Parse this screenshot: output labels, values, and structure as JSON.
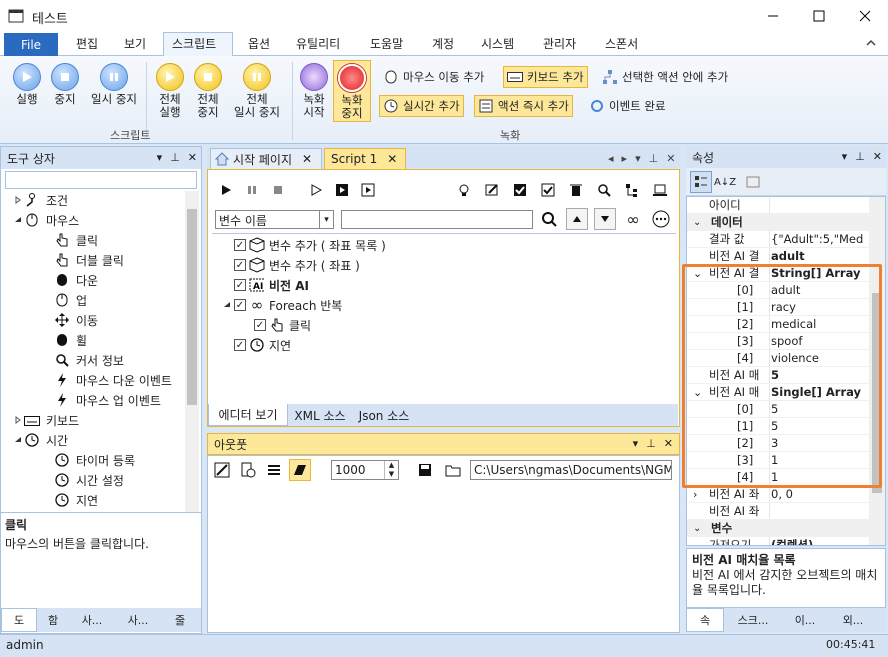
{
  "window": {
    "title": "테스트"
  },
  "menu": {
    "file": "File",
    "items": [
      "편집",
      "보기",
      "스크립트",
      "옵션",
      "유틸리티",
      "도움말",
      "계정",
      "시스템",
      "관리자",
      "스폰서"
    ]
  },
  "ribbon": {
    "run": "실행",
    "stop": "중지",
    "pause": "일시 중지",
    "run_all": [
      "전체",
      "실행"
    ],
    "stop_all": [
      "전체",
      "중지"
    ],
    "pause_all": [
      "전체",
      "일시 중지"
    ],
    "record_start": [
      "녹화",
      "시작"
    ],
    "record_stop": [
      "녹화",
      "중지"
    ],
    "mouse_move": "마우스 이동 추가",
    "keyboard": "키보드 추가",
    "inside_action": "선택한 액션 안에 추가",
    "realtime": "실시간 추가",
    "action_instant": "액션 즉시 추가",
    "event_done": "이벤트 완료",
    "group_script": "스크립트",
    "group_record": "녹화"
  },
  "toolbox": {
    "title": "도구 상자",
    "items": [
      "조건",
      "마우스",
      "클릭",
      "더블 클릭",
      "다운",
      "업",
      "이동",
      "휠",
      "커서 정보",
      "마우스 다운 이벤트",
      "마우스 업 이벤트",
      "키보드",
      "시간",
      "타이머 등록",
      "시간 설정",
      "지연"
    ],
    "desc_title": "클릭",
    "desc_text": "마우스의 버튼을 클릭합니다.",
    "tabs": [
      "도",
      "함",
      "사...",
      "사...",
      "줄"
    ]
  },
  "editor": {
    "tabs": [
      "시작 페이지",
      "Script 1"
    ],
    "var_placeholder": "변수 이름",
    "nodes": [
      "변수 추가 ( 좌표 목록 )",
      "변수 추가 ( 좌표 )",
      "비전 AI",
      "Foreach 반복",
      "클릭",
      "지연"
    ],
    "bottom_tabs": [
      "에디터 보기",
      "XML 소스",
      "Json 소스"
    ]
  },
  "output": {
    "title": "아웃풋",
    "count": "1000",
    "path": "C:\\Users\\ngmas\\Documents\\NGM6\\"
  },
  "props": {
    "title": "속성",
    "rows": [
      {
        "k": "아이디",
        "v": ""
      },
      {
        "cat": "데이터"
      },
      {
        "k": "결과 값",
        "v": "{\"Adult\":5,\"Med"
      },
      {
        "k": "비전 AI 결",
        "v": "adult"
      },
      {
        "k": "비전 AI 결",
        "v": "String[] Array"
      },
      {
        "k": "[0]",
        "v": "adult",
        "sub": true
      },
      {
        "k": "[1]",
        "v": "racy",
        "sub": true
      },
      {
        "k": "[2]",
        "v": "medical",
        "sub": true
      },
      {
        "k": "[3]",
        "v": "spoof",
        "sub": true
      },
      {
        "k": "[4]",
        "v": "violence",
        "sub": true
      },
      {
        "k": "비전 AI 매",
        "v": "5"
      },
      {
        "k": "비전 AI 매",
        "v": "Single[] Array"
      },
      {
        "k": "[0]",
        "v": "5",
        "sub": true
      },
      {
        "k": "[1]",
        "v": "5",
        "sub": true
      },
      {
        "k": "[2]",
        "v": "3",
        "sub": true
      },
      {
        "k": "[3]",
        "v": "1",
        "sub": true
      },
      {
        "k": "[4]",
        "v": "1",
        "sub": true
      },
      {
        "k": "비전 AI 좌",
        "v": "0, 0"
      },
      {
        "k": "비전 AI 좌",
        "v": ""
      },
      {
        "cat": "변수"
      },
      {
        "k": "가져오기",
        "v": "(컬렉션)"
      }
    ],
    "desc_title": "비전 AI 매치율 목록",
    "desc_text": "비전 AI 에서 감지한 오브젝트의 매치율 목록입니다.",
    "tabs": [
      "속",
      "스크...",
      "이...",
      "외..."
    ]
  },
  "status": {
    "user": "admin",
    "time": "00:45:41"
  },
  "colors": {
    "accent": "#2b6bbf",
    "highlight": "#f08030"
  }
}
